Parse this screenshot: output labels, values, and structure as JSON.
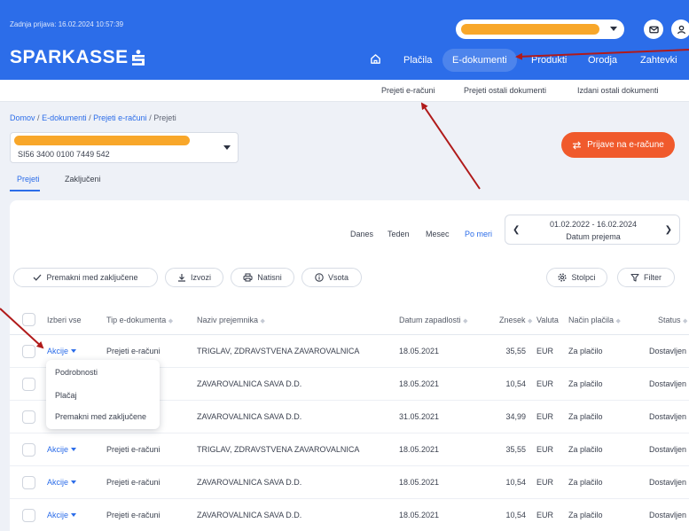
{
  "header": {
    "last_login": "Zadnja prijava: 16.02.2024 10:57:39",
    "logo": "SPARKASSE",
    "nav": [
      {
        "label": "Plačila",
        "active": false
      },
      {
        "label": "E-dokumenti",
        "active": true
      },
      {
        "label": "Produkti",
        "active": false
      },
      {
        "label": "Orodja",
        "active": false
      },
      {
        "label": "Zahtevki",
        "active": false
      }
    ],
    "icons": [
      "home-icon",
      "mail-icon",
      "user-icon"
    ]
  },
  "subnav": [
    "Prejeti e-računi",
    "Prejeti ostali dokumenti",
    "Izdani ostali dokumenti"
  ],
  "breadcrumb": {
    "items": [
      "Domov",
      "E-dokumenti",
      "Prejeti e-računi",
      "Prejeti"
    ],
    "separator": "/"
  },
  "account": {
    "iban": "SI56 3400 0100 7449 542"
  },
  "einvoice_button": "Prijave na e-račune",
  "tabs": [
    {
      "label": "Prejeti",
      "active": true
    },
    {
      "label": "Zaključeni",
      "active": false
    }
  ],
  "period_filters": [
    {
      "label": "Danes",
      "active": false
    },
    {
      "label": "Teden",
      "active": false
    },
    {
      "label": "Mesec",
      "active": false
    },
    {
      "label": "Po meri",
      "active": true
    }
  ],
  "date_range": {
    "range": "01.02.2022 - 16.02.2024",
    "label": "Datum prejema"
  },
  "actions": [
    "Premakni med zaključene",
    "Izvozi",
    "Natisni",
    "Vsota"
  ],
  "right_actions": [
    "Stolpci",
    "Filter"
  ],
  "table": {
    "select_all": "Izberi vse",
    "columns": [
      "Tip e-dokumenta",
      "Naziv prejemnika",
      "Datum zapadlosti",
      "Znesek",
      "Valuta",
      "Način plačila",
      "Status"
    ],
    "actions_label": "Akcije",
    "rows": [
      [
        "Prejeti e-računi",
        "TRIGLAV, ZDRAVSTVENA ZAVAROVALNICA",
        "18.05.2021",
        "35,55",
        "EUR",
        "Za plačilo",
        "Dostavljen"
      ],
      [
        "Prejeti e-računi",
        "ZAVAROVALNICA SAVA D.D.",
        "18.05.2021",
        "10,54",
        "EUR",
        "Za plačilo",
        "Dostavljen"
      ],
      [
        "Prejeti e-računi",
        "ZAVAROVALNICA SAVA D.D.",
        "31.05.2021",
        "34,99",
        "EUR",
        "Za plačilo",
        "Dostavljen"
      ],
      [
        "Prejeti e-računi",
        "TRIGLAV, ZDRAVSTVENA ZAVAROVALNICA",
        "18.05.2021",
        "35,55",
        "EUR",
        "Za plačilo",
        "Dostavljen"
      ],
      [
        "Prejeti e-računi",
        "ZAVAROVALNICA SAVA D.D.",
        "18.05.2021",
        "10,54",
        "EUR",
        "Za plačilo",
        "Dostavljen"
      ],
      [
        "Prejeti e-računi",
        "ZAVAROVALNICA SAVA D.D.",
        "18.05.2021",
        "10,54",
        "EUR",
        "Za plačilo",
        "Dostavljen"
      ]
    ]
  },
  "dropdown_menu": [
    "Podrobnosti",
    "Plačaj",
    "Premakni med zaključene"
  ],
  "colors": {
    "brand_blue": "#2c6de9",
    "accent_orange": "#f05a2c",
    "redaction": "#f8a72a",
    "annotation_red": "#b01a1a"
  }
}
